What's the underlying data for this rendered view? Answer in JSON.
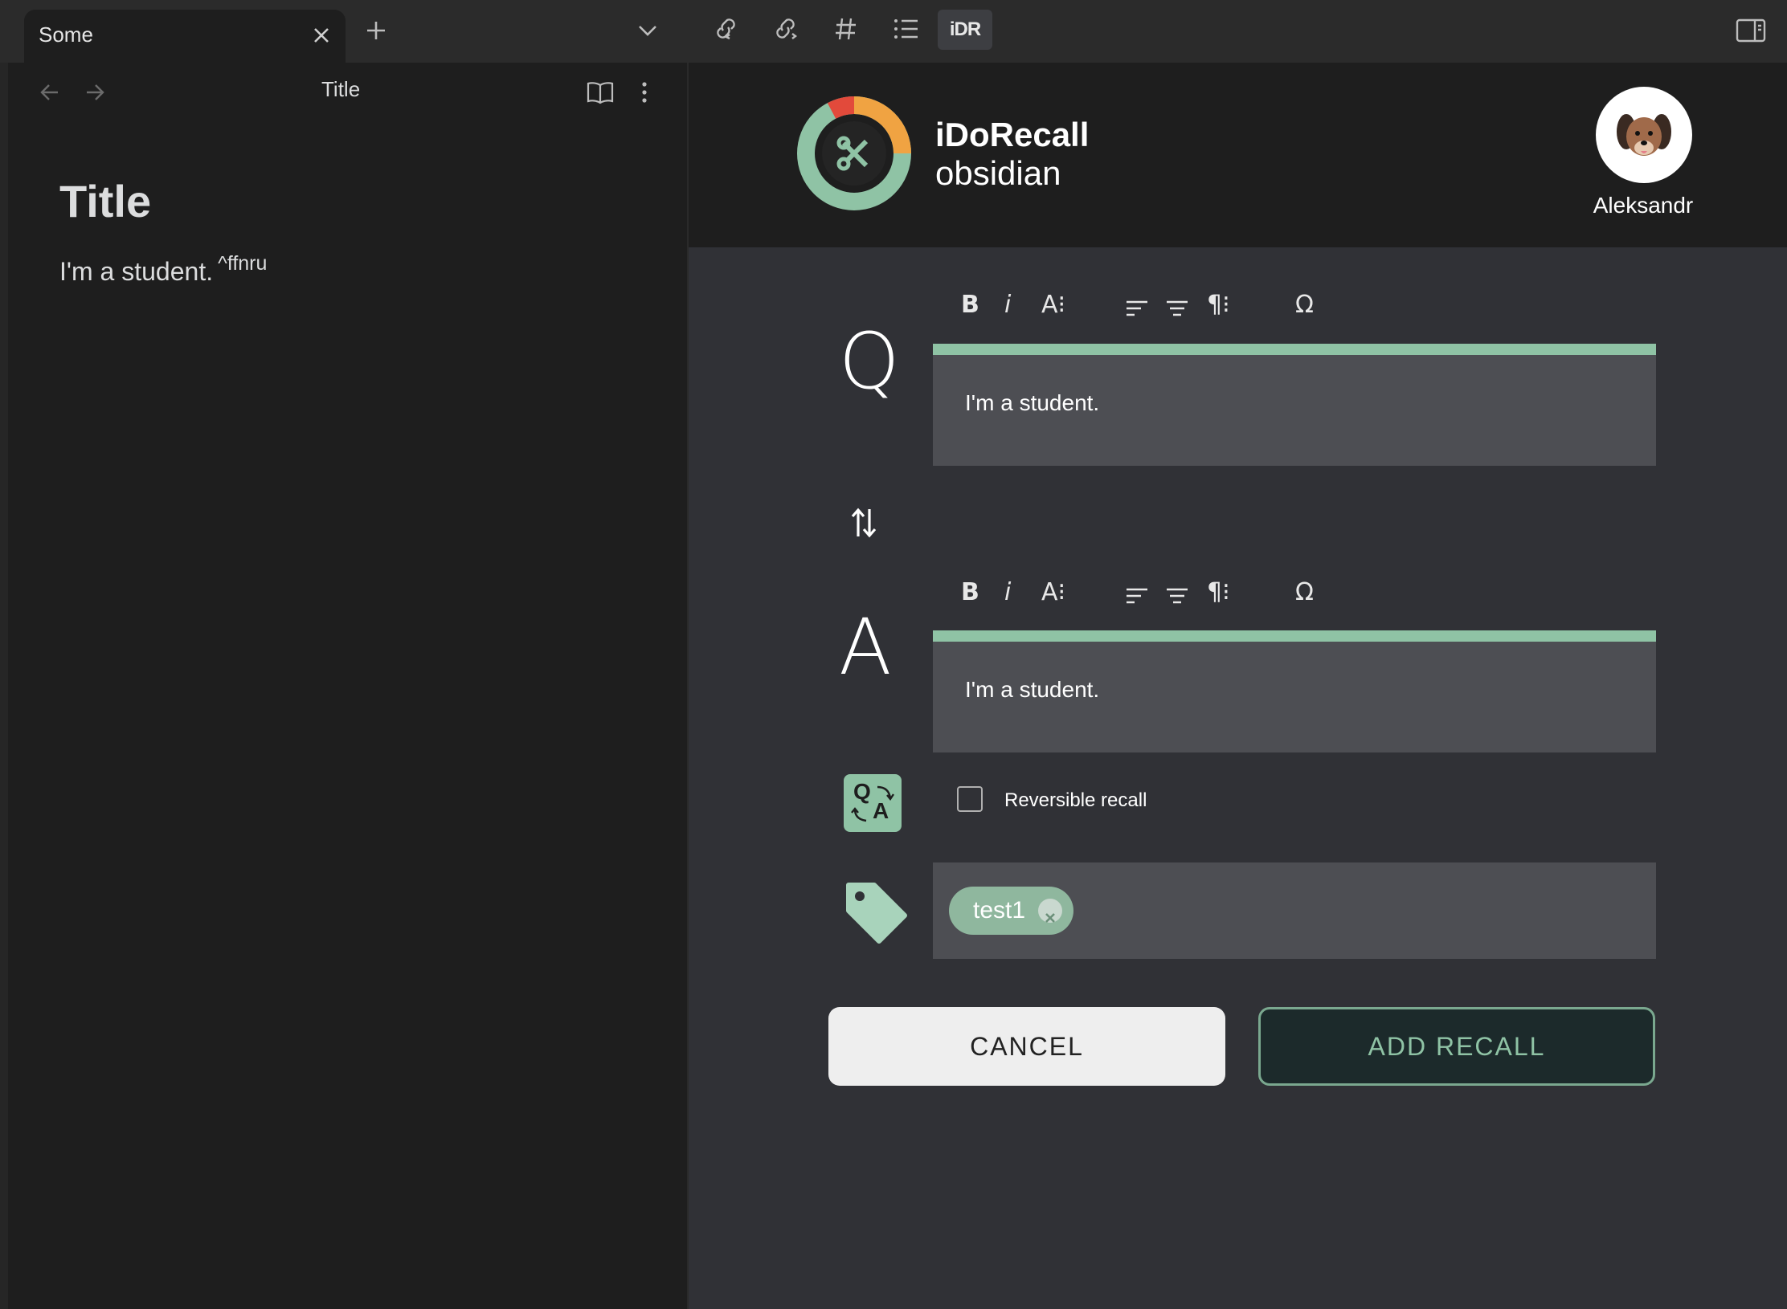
{
  "tab": {
    "title": "Some"
  },
  "left_pane": {
    "header_title": "Title",
    "doc_title": "Title",
    "doc_line": "I'm a student.",
    "block_id": "^ffnru"
  },
  "plugin": {
    "brand_line1": "iDoRecall",
    "brand_line2": "obsidian",
    "ribbon_icon_text": "iDR",
    "user_name": "Aleksandr",
    "question_letter": "Q",
    "answer_letter": "A",
    "qa_icon_letters": [
      "Q",
      "A"
    ],
    "toolbar": {
      "bold": "B",
      "italic": "i",
      "font_size": "A⁝",
      "para": "¶⁝",
      "omega": "Ω"
    },
    "question_text": "I'm a student.",
    "answer_text": "I'm a student.",
    "reversible_label": "Reversible recall",
    "reversible_checked": false,
    "tags": [
      "test1"
    ],
    "cancel_label": "CANCEL",
    "add_label": "ADD RECALL"
  },
  "colors": {
    "accent": "#8fc3a5",
    "editor_bg": "#4d4e53",
    "pane_bg": "#303136"
  }
}
